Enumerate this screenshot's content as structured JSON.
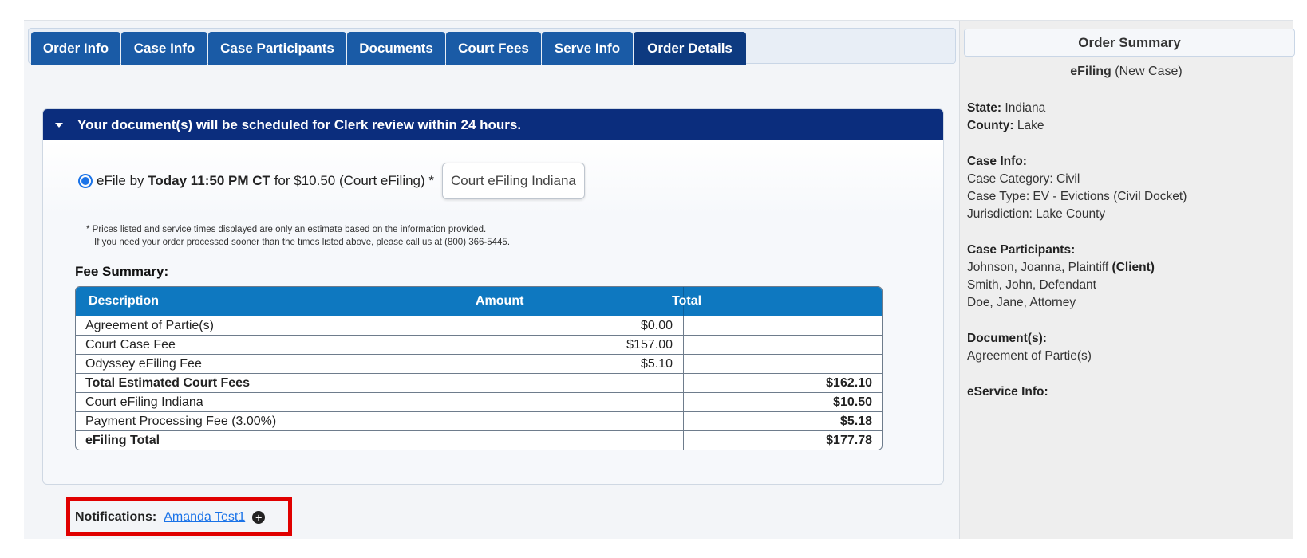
{
  "tabs": [
    {
      "label": "Order Info"
    },
    {
      "label": "Case Info"
    },
    {
      "label": "Case Participants"
    },
    {
      "label": "Documents"
    },
    {
      "label": "Court Fees"
    },
    {
      "label": "Serve Info"
    },
    {
      "label": "Order Details"
    }
  ],
  "active_tab": "Order Details",
  "review": {
    "header": "Your document(s) will be scheduled for Clerk review within 24 hours.",
    "efile_prefix": "eFile by",
    "efile_deadline": "Today 11:50 PM CT",
    "efile_suffix": "for $10.50 (Court eFiling) *",
    "provider": "Court eFiling Indiana",
    "disclaimer_line1": "* Prices listed and service times displayed are only an estimate based on the information provided.",
    "disclaimer_line2": "If you need your order processed sooner than the times listed above, please call us at (800) 366-5445."
  },
  "fee_summary": {
    "title": "Fee Summary:",
    "columns": {
      "description": "Description",
      "amount": "Amount",
      "total": "Total"
    },
    "rows": [
      {
        "description": "Agreement of Partie(s)",
        "amount": "$0.00",
        "total": ""
      },
      {
        "description": "Court Case Fee",
        "amount": "$157.00",
        "total": ""
      },
      {
        "description": "Odyssey eFiling Fee",
        "amount": "$5.10",
        "total": ""
      },
      {
        "description": "Total Estimated Court Fees",
        "amount": "",
        "total": "$162.10"
      },
      {
        "description": "Court eFiling Indiana",
        "amount": "",
        "total": "$10.50"
      },
      {
        "description": "Payment Processing Fee (3.00%)",
        "amount": "",
        "total": "$5.18"
      },
      {
        "description": "eFiling Total",
        "amount": "",
        "total": "$177.78"
      }
    ]
  },
  "notifications": {
    "label": "Notifications:",
    "recipient": "Amanda Test1"
  },
  "summary": {
    "title": "Order Summary",
    "type_bold": "eFiling",
    "type_rest": "(New Case)",
    "state_label": "State:",
    "state": "Indiana",
    "county_label": "County:",
    "county": "Lake",
    "case_info_label": "Case Info:",
    "case_category": "Case Category: Civil",
    "case_type": "Case Type: EV - Evictions (Civil Docket)",
    "jurisdiction": "Jurisdiction: Lake County",
    "participants_label": "Case Participants:",
    "participant_1": "Johnson, Joanna, Plaintiff",
    "participant_1_tag": "(Client)",
    "participant_2": "Smith, John, Defendant",
    "participant_3": "Doe, Jane, Attorney",
    "documents_label": "Document(s):",
    "document_1": "Agreement of Partie(s)",
    "eservice_label": "eService Info:"
  }
}
